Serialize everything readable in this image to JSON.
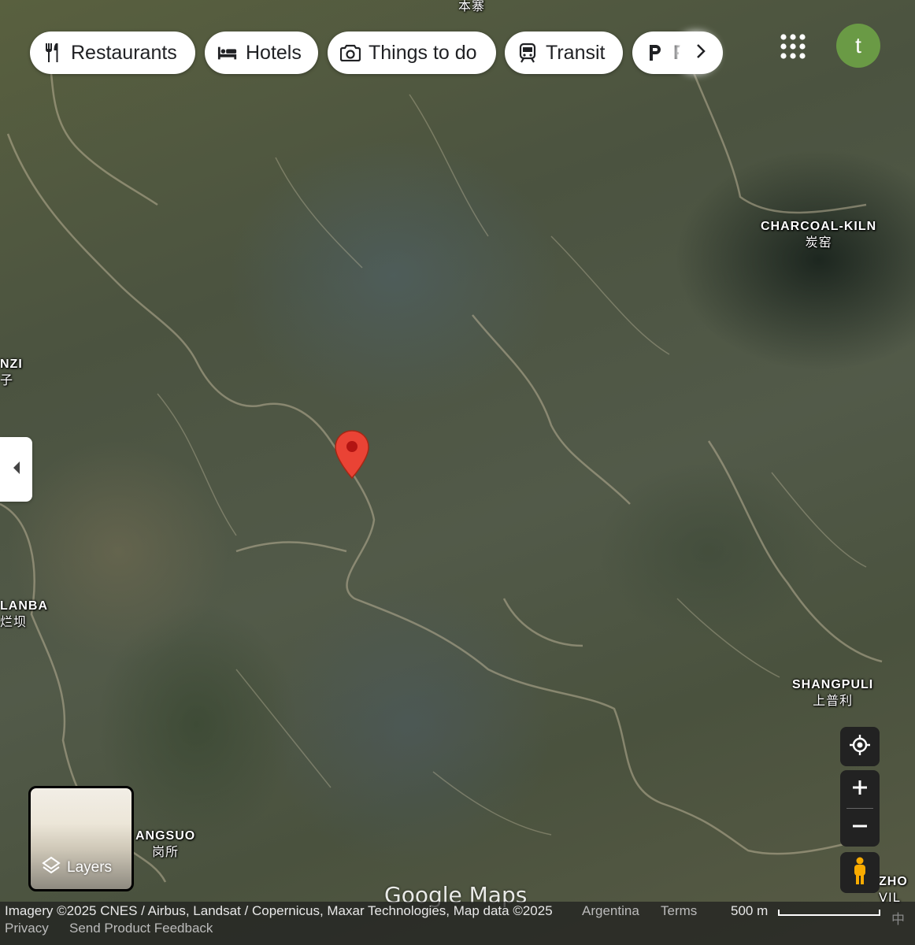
{
  "toolbar": {
    "chips": [
      {
        "label": "Restaurants",
        "icon": "restaurant-icon"
      },
      {
        "label": "Hotels",
        "icon": "hotel-icon"
      },
      {
        "label": "Things to do",
        "icon": "camera-icon"
      },
      {
        "label": "Transit",
        "icon": "train-icon"
      },
      {
        "label": "P",
        "icon": "parking-icon"
      }
    ],
    "more_icon": "chevron-right-icon",
    "apps_icon": "apps-grid-icon",
    "avatar_letter": "t",
    "avatar_color": "#6a9a45"
  },
  "map": {
    "places": [
      {
        "name": "CHARCOAL-KILN",
        "local": "炭窑"
      },
      {
        "name": "SHANGPULI",
        "local": "上普利"
      },
      {
        "name": "NZI",
        "local": "子"
      },
      {
        "name": "LANBA",
        "local": "烂坝"
      },
      {
        "name": "ANGSUO",
        "local": "岗所"
      },
      {
        "name": "ZHO",
        "local": "VIL"
      },
      {
        "name": "",
        "local": "本寨"
      }
    ],
    "pin_color": "#ea4335"
  },
  "layers": {
    "label": "Layers"
  },
  "branding": {
    "logo": "Google Maps"
  },
  "footer": {
    "imagery": "Imagery ©2025 CNES / Airbus, Landsat / Copernicus, Maxar Technologies, Map data ©2025",
    "country": "Argentina",
    "terms": "Terms",
    "scale": "500 m",
    "privacy": "Privacy",
    "feedback": "Send Product Feedback",
    "lang": "中"
  }
}
